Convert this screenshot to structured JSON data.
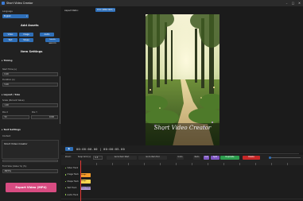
{
  "window": {
    "title": "Short Video Creator",
    "minimize": "–",
    "maximize": "□",
    "close": "✕"
  },
  "sidebar": {
    "language_label": "Language",
    "language_value": "English",
    "add_assets_title": "Add Assets",
    "assets": [
      "Video",
      "Image",
      "Audio",
      "Text",
      "Shape",
      "Subtitle (SRT/VTT)"
    ],
    "item_settings_title": "Item Settings",
    "timing": {
      "header": "▸ Timing",
      "start_label": "Start Time (s)",
      "start_value": "0.00",
      "duration_label": "Duration (s)",
      "duration_value": "5.00"
    },
    "layout": {
      "header": "▸ Layout / Size",
      "scale_label": "Scale (Percent Value)",
      "scale_value": "1.00",
      "posx_label": "Pos X",
      "posy_label": "Pos Y",
      "posx_value": "50",
      "posy_value": "1000"
    },
    "text": {
      "header": "▸ Text Settings",
      "content_label": "Content",
      "content_value": "Short Video Creator",
      "font_size_label": "Font Size (Value %) (%)",
      "font_size_value": "48(5%)"
    },
    "export_label": "Export Video (MP4)"
  },
  "main": {
    "aspect_label": "Aspect Ratio:",
    "aspect_value": "9:16 (1080x1920)",
    "video_title": "Short Video Creator",
    "play_icon": "▶",
    "timecode": "00:00:00.00 | 00:00:05.00"
  },
  "toolbar": {
    "zoom_label": "Zoom:",
    "snap_label": "Snap Grid (s):",
    "snap_value": "0.5",
    "goto_start": "Go to Item Start",
    "goto_end": "Go to Item End",
    "undo": "Undo",
    "redo": "Redo",
    "cut": "Cut",
    "split": "Split",
    "duplicate": "Duplicate",
    "delete": "Delete"
  },
  "tracks": [
    {
      "name": "Video Track"
    },
    {
      "name": "Image Track"
    },
    {
      "name": "Shape Track"
    },
    {
      "name": "Text Track"
    },
    {
      "name": "Audio Track"
    }
  ],
  "clips": {
    "image": "Image",
    "shape": "Shape",
    "text": "Short Video C."
  },
  "colors": {
    "accent": "#2f6fb8",
    "export": "#d84c82",
    "duplicate": "#2e9e4f",
    "delete": "#c62828",
    "cut": "#7e57c2",
    "image_clip": "#f59c2a",
    "shape_clip": "#ffd54f",
    "text_clip": "#b39ddb"
  }
}
